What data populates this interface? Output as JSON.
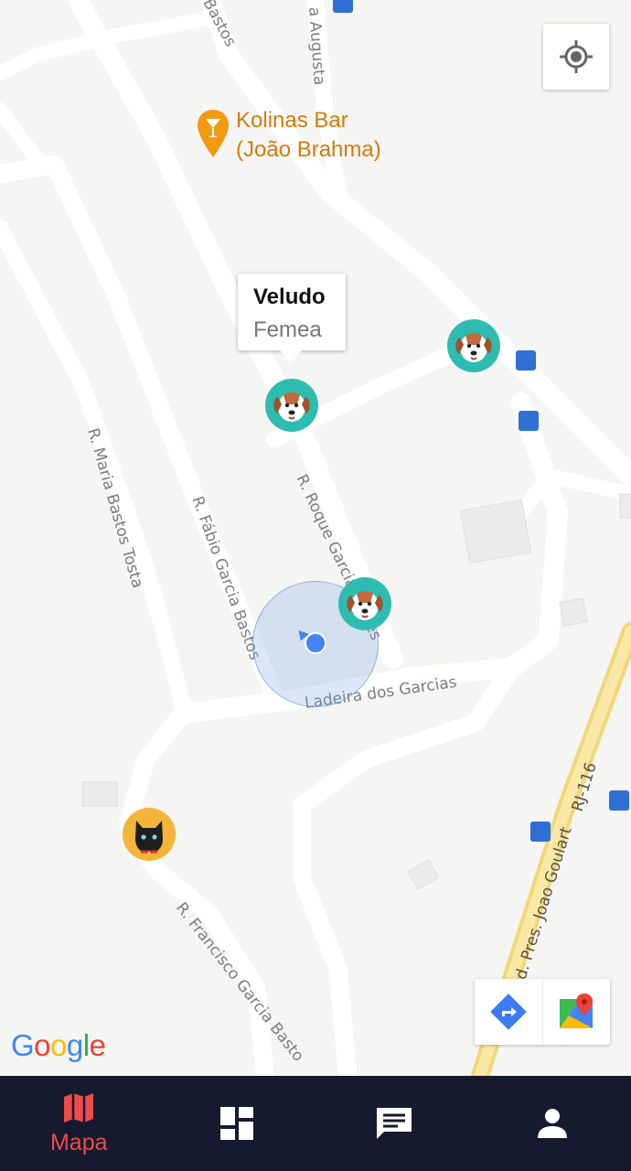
{
  "map": {
    "poi": {
      "name_line1": "Kolinas Bar",
      "name_line2": "(João Brahma)",
      "icon": "bar-pin-icon"
    },
    "info_window": {
      "title": "Veludo",
      "subtitle": "Femea"
    },
    "road_labels": {
      "bastos_top": "Bastos",
      "augusta": "a Augusta",
      "maria_bastos_tosta": "R. Maria Bastos Tosta",
      "fabio_garcia_bastos": "R. Fábio Garcia Bastos",
      "roque_garcia": "R. Roque Garcia Fontes",
      "ladeira": "Ladeira dos Garcias",
      "francisco": "R. Francisco Garcia Basto",
      "rodovia": "Rod. Pres. Joao Goulart",
      "rj116": "RJ-116"
    },
    "attribution": "Google",
    "controls": {
      "locate_icon": "my-location-icon",
      "directions_icon": "directions-icon",
      "maps_icon": "google-maps-icon"
    }
  },
  "nav": {
    "items": [
      {
        "label": "Mapa",
        "icon": "map-icon",
        "active": true
      },
      {
        "label": "",
        "icon": "dashboard-icon",
        "active": false
      },
      {
        "label": "",
        "icon": "chat-icon",
        "active": false
      },
      {
        "label": "",
        "icon": "person-icon",
        "active": false
      }
    ]
  },
  "colors": {
    "accent": "#ee4b4b",
    "navbar": "#151a2e",
    "poi": "#d67a08",
    "dog_marker": "#2fbcb0",
    "cat_marker": "#f5b43a",
    "location": "#4285f4"
  }
}
